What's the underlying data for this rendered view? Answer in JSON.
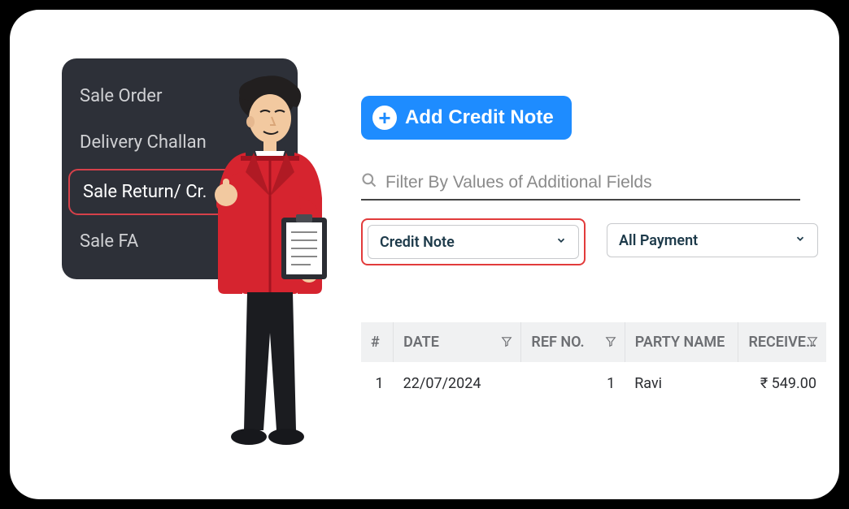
{
  "sidebar": {
    "items": [
      {
        "label": "Sale Order",
        "active": false
      },
      {
        "label": "Delivery Challan",
        "active": false
      },
      {
        "label": "Sale Return/ Cr.",
        "active": true
      },
      {
        "label": "Sale FA",
        "active": false
      }
    ]
  },
  "add_button": {
    "label": "Add Credit Note"
  },
  "filter": {
    "placeholder": "Filter By Values of Additional Fields"
  },
  "dropdowns": {
    "type": {
      "selected": "Credit Note"
    },
    "payment": {
      "selected": "All Payment"
    }
  },
  "table": {
    "headers": {
      "idx": "#",
      "date": "DATE",
      "ref": "REF NO.",
      "party": "PARTY NAME",
      "received": "RECEIVE…"
    },
    "rows": [
      {
        "idx": "1",
        "date": "22/07/2024",
        "ref": "1",
        "party": "Ravi",
        "received": "₹ 549.00"
      }
    ]
  },
  "colors": {
    "accent_blue": "#1e8cff",
    "highlight_red": "#e23b3b",
    "sidebar_bg": "#2d3038"
  }
}
